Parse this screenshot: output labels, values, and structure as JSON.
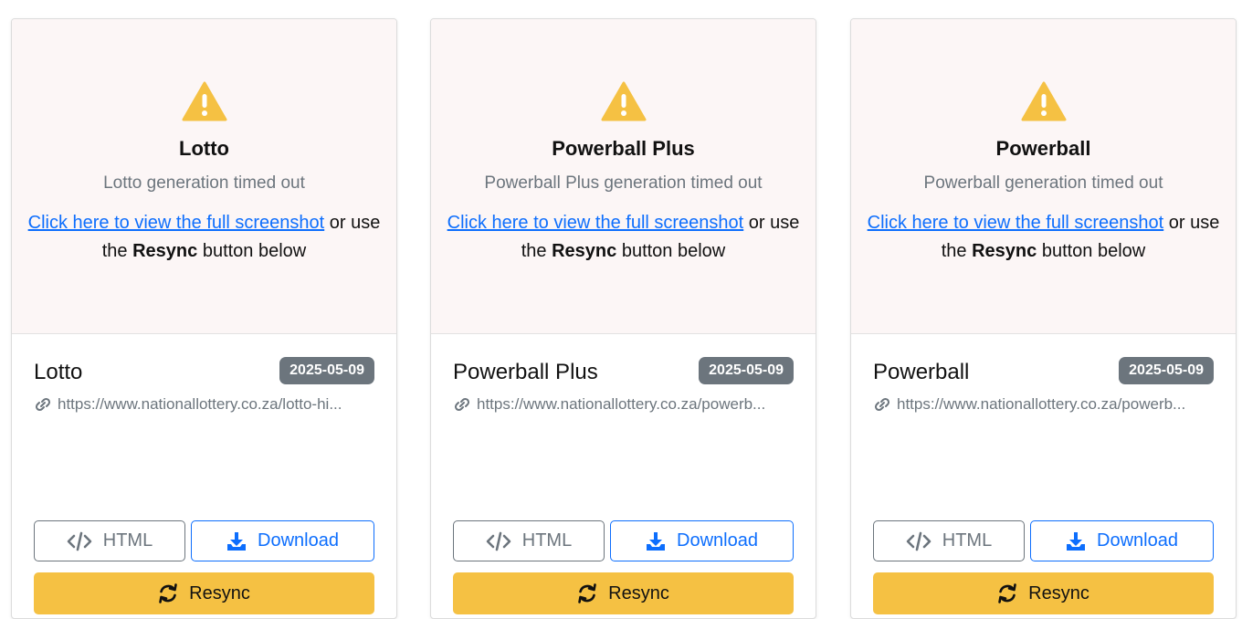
{
  "cards": [
    {
      "preview_title": "Lotto",
      "preview_message": "Lotto generation timed out",
      "help_link": "Click here to view the full screenshot",
      "help_text_1": " or use the ",
      "help_bold": "Resync",
      "help_text_2": " button below",
      "title": "Lotto",
      "date": "2025-05-09",
      "url": "https://www.nationallottery.co.za/lotto-hi...",
      "html_label": "HTML",
      "download_label": "Download",
      "resync_label": "Resync"
    },
    {
      "preview_title": "Powerball Plus",
      "preview_message": "Powerball Plus generation timed out",
      "help_link": "Click here to view the full screenshot",
      "help_text_1": " or use the ",
      "help_bold": "Resync",
      "help_text_2": " button below",
      "title": "Powerball Plus",
      "date": "2025-05-09",
      "url": "https://www.nationallottery.co.za/powerb...",
      "html_label": "HTML",
      "download_label": "Download",
      "resync_label": "Resync"
    },
    {
      "preview_title": "Powerball",
      "preview_message": "Powerball generation timed out",
      "help_link": "Click here to view the full screenshot",
      "help_text_1": " or use the ",
      "help_bold": "Resync",
      "help_text_2": " button below",
      "title": "Powerball",
      "date": "2025-05-09",
      "url": "https://www.nationallottery.co.za/powerb...",
      "html_label": "HTML",
      "download_label": "Download",
      "resync_label": "Resync"
    }
  ],
  "icons": {
    "warning": "warning-triangle-icon",
    "link": "link-icon",
    "code": "code-icon",
    "download": "download-icon",
    "resync": "refresh-icon"
  },
  "colors": {
    "warning": "#f5c143",
    "badge": "#6c757d",
    "link": "#0d6efd",
    "resync": "#f5c143",
    "preview_bg": "#fcf6f6"
  }
}
